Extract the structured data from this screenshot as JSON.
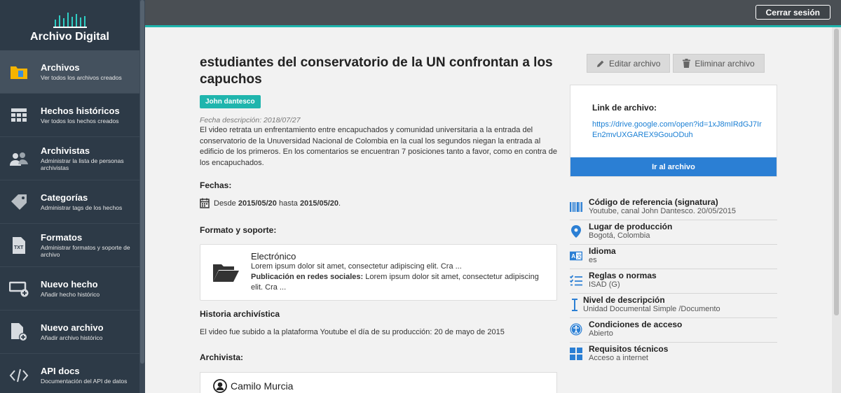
{
  "sidebar": {
    "brand": "Archivo Digital",
    "items": [
      {
        "label": "Archivos",
        "sub": "Ver todos los archivos creados",
        "icon": "folder-icon"
      },
      {
        "label": "Hechos históricos",
        "sub": "Ver todos los hechos creados",
        "icon": "grid-icon"
      },
      {
        "label": "Archivistas",
        "sub": "Administrar la lista de personas archivistas",
        "icon": "users-icon"
      },
      {
        "label": "Categorías",
        "sub": "Administrar tags de los hechos",
        "icon": "tag-icon"
      },
      {
        "label": "Formatos",
        "sub": "Administrar formatos y soporte de archivo",
        "icon": "txt-file-icon"
      },
      {
        "label": "Nuevo hecho",
        "sub": "Añadir hecho histórico",
        "icon": "add-window-icon"
      },
      {
        "label": "Nuevo archivo",
        "sub": "Añadir archivo histórico",
        "icon": "add-file-icon"
      },
      {
        "label": "API docs",
        "sub": "Documentación del API de datos",
        "icon": "code-icon"
      }
    ]
  },
  "topbar": {
    "logout_label": "Cerrar sesión"
  },
  "main": {
    "title": "estudiantes del conservatorio de la UN confrontan a los capuchos",
    "tag": "John dantesco",
    "desc_date": "Fecha descripción: 2018/07/27",
    "description": "El video retrata un enfrentamiento entre encapuchados y comunidad universitaria a la entrada del conservatorio de la Unuversidad Nacional de Colombia en la cual los segundos niegan la entrada al edificio de los primeros. En los comentarios se encuentran 7 posiciones tanto a favor, como en contra de los encapuchados.",
    "dates_title": "Fechas:",
    "dates": {
      "prefix": "Desde",
      "from": "2015/05/20",
      "middle": "hasta",
      "to": "2015/05/20",
      "suffix": "."
    },
    "format_title": "Formato y soporte:",
    "format": {
      "name": "Electrónico",
      "desc": "Lorem ipsum dolor sit amet, consectetur adipiscing elit. Cra ...",
      "pub_label": "Publicación en redes sociales:",
      "pub_desc": "Lorem ipsum dolor sit amet, consectetur adipiscing elit. Cra ..."
    },
    "history_title": "Historia archivística",
    "history": "El video fue subido a la plataforma Youtube el día de su producción: 20 de mayo de 2015",
    "archivist_title": "Archivista:",
    "archivist_name": "Camilo Murcia"
  },
  "actions": {
    "edit": "Editar archivo",
    "delete": "Eliminar archivo"
  },
  "link_card": {
    "label": "Link de archivo:",
    "url": "https://drive.google.com/open?id=1xJ8mIRdGJ7IrEn2mvUXGAREX9GouODuh",
    "go": "Ir al archivo"
  },
  "meta": [
    {
      "title": "Código de referencia (signatura)",
      "value": "Youtube, canal John Dantesco. 20/05/2015",
      "icon": "barcode-icon"
    },
    {
      "title": "Lugar de producción",
      "value": "Bogotá, Colombia",
      "icon": "location-pin-icon"
    },
    {
      "title": "Idioma",
      "value": "es",
      "icon": "translate-icon"
    },
    {
      "title": "Reglas o normas",
      "value": "ISAD (G)",
      "icon": "checklist-icon"
    },
    {
      "title": "Nivel de descripción",
      "value": "Unidad Documental Simple /Documento",
      "icon": "text-cursor-icon"
    },
    {
      "title": "Condiciones de acceso",
      "value": "Abierto",
      "icon": "accessibility-icon"
    },
    {
      "title": "Requisitos técnicos",
      "value": "Acceso a internet",
      "icon": "windows-icon"
    }
  ],
  "colors": {
    "accent": "#1fb5ad",
    "link": "#1a7fd4",
    "primary_button": "#2b7fd4",
    "sidebar": "#2d3a47"
  }
}
